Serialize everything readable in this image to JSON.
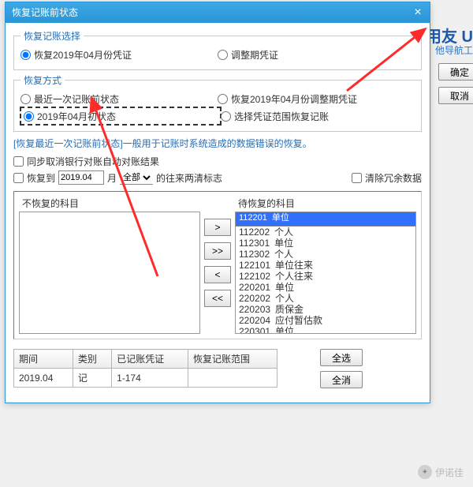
{
  "bg": {
    "brand": "用友 U",
    "sub": "他导航工"
  },
  "dialog": {
    "title": "恢复记账前状态",
    "close": "×",
    "group1": {
      "legend": "恢复记账选择",
      "opt1": "恢复2019年04月份凭证",
      "opt2": "调整期凭证"
    },
    "group2": {
      "legend": "恢复方式",
      "r1": "最近一次记账前状态",
      "r2": "恢复2019年04月份调整期凭证",
      "r3": "2019年04月初状态",
      "r4": "选择凭证范围恢复记账"
    },
    "desc": "[恢复最近一次记账前状态]一般用于记账时系统造成的数据错误的恢复。",
    "chk_sync": "同步取消银行对账自动对账结果",
    "chk_restore_to": "恢复到",
    "restore_period": "2019.04",
    "month_lbl": "月",
    "scope": "全部",
    "suffix": "的往来两清标志",
    "chk_clear": "清除冗余数据",
    "left_list_lbl": "不恢复的科目",
    "right_list_lbl": "待恢复的科目",
    "move": {
      "r": ">",
      "rr": ">>",
      "l": "<",
      "ll": "<<"
    },
    "right_items": [
      {
        "code": "112201",
        "name": "单位",
        "sel": true
      },
      {
        "code": "112202",
        "name": "个人"
      },
      {
        "code": "112301",
        "name": "单位"
      },
      {
        "code": "112302",
        "name": "个人"
      },
      {
        "code": "122101",
        "name": "单位往来"
      },
      {
        "code": "122102",
        "name": "个人往来"
      },
      {
        "code": "220201",
        "name": "单位"
      },
      {
        "code": "220202",
        "name": "个人"
      },
      {
        "code": "220203",
        "name": "质保金"
      },
      {
        "code": "220204",
        "name": "应付暂估款"
      },
      {
        "code": "220301",
        "name": "单位"
      }
    ],
    "table": {
      "h1": "期间",
      "h2": "类别",
      "h3": "已记账凭证",
      "h4": "恢复记账范围",
      "r": {
        "c1": "2019.04",
        "c2": "记",
        "c3": "1-174",
        "c4": ""
      }
    },
    "side": {
      "all": "全选",
      "none": "全消"
    }
  },
  "ext": {
    "ok": "确定",
    "cancel": "取消"
  },
  "wm": "伊诺佳"
}
